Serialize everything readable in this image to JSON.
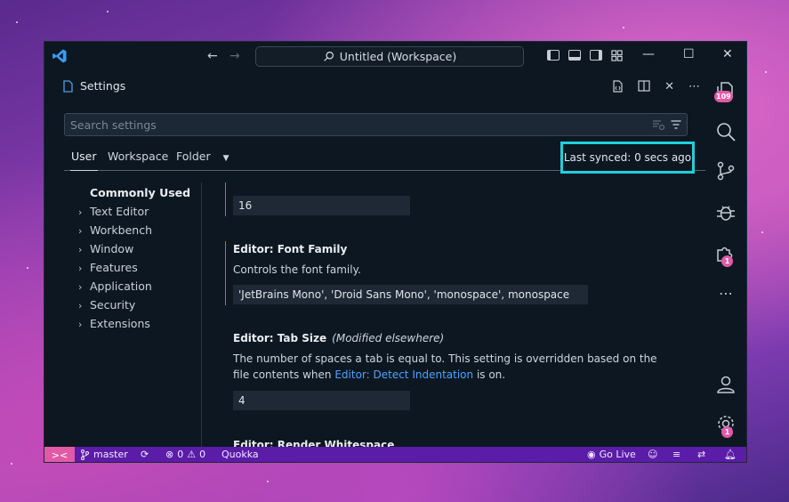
{
  "window": {
    "nav_back": "←",
    "nav_forward": "→",
    "command_center": "Untitled (Workspace)",
    "minimize": "—",
    "maximize": "☐",
    "close": "✕"
  },
  "editor_tab": {
    "title": "Settings",
    "actions": [
      "open-json-icon",
      "split-editor-icon",
      "close-icon",
      "more-actions-icon"
    ]
  },
  "search": {
    "placeholder": "Search settings"
  },
  "scopes": {
    "user": "User",
    "workspace": "Workspace",
    "folder": "Folder",
    "sync_status": "Last synced: 0 secs ago"
  },
  "toc": {
    "heading": "Commonly Used",
    "items": [
      "Text Editor",
      "Workbench",
      "Window",
      "Features",
      "Application",
      "Security",
      "Extensions"
    ]
  },
  "settings": {
    "font_size_value": "16",
    "font_family": {
      "title": "Editor: Font Family",
      "description": "Controls the font family.",
      "value": "'JetBrains Mono', 'Droid Sans Mono', 'monospace', monospace"
    },
    "tab_size": {
      "title": "Editor: Tab Size",
      "modified": "(Modified elsewhere)",
      "description_pre": "The number of spaces a tab is equal to. This setting is overridden based on the file contents when ",
      "description_link": "Editor: Detect Indentation",
      "description_post": " is on.",
      "value": "4"
    },
    "render_whitespace": {
      "title": "Editor: Render Whitespace"
    }
  },
  "activity_bar": {
    "explorer_badge": "109",
    "extensions_badge": "1",
    "settings_badge": "1"
  },
  "statusbar": {
    "remote": "><",
    "branch": "master",
    "errors": "0",
    "warnings": "0",
    "quokka": "Quokka",
    "go_live": "Go Live"
  },
  "colors": {
    "accent_sync_border": "#20d0dc",
    "statusbar_bg": "#5b1ca8",
    "badge": "#e25aa6",
    "link": "#4aa3ff"
  }
}
